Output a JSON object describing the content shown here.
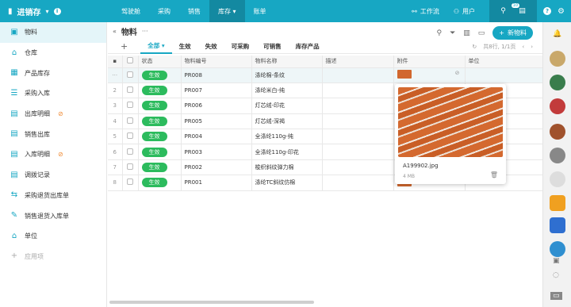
{
  "topbar": {
    "app_name": "进销存",
    "nav": [
      "驾驶舱",
      "采购",
      "销售",
      "库存",
      "账单"
    ],
    "active_nav": "库存",
    "workflow_label": "工作流",
    "user_label": "用户",
    "notif_count": "10"
  },
  "sidebar": {
    "items": [
      {
        "label": "物料",
        "icon": "box-icon",
        "active": true
      },
      {
        "label": "仓库",
        "icon": "warehouse-icon"
      },
      {
        "label": "产品库存",
        "icon": "inventory-icon"
      },
      {
        "label": "采购入库",
        "icon": "checklist-icon"
      },
      {
        "label": "出库明细",
        "icon": "document-icon",
        "hidden_icon": true
      },
      {
        "label": "销售出库",
        "icon": "document-icon"
      },
      {
        "label": "入库明细",
        "icon": "document-icon",
        "hidden_icon": true
      },
      {
        "label": "调拨记录",
        "icon": "document-icon"
      },
      {
        "label": "采购退货出库单",
        "icon": "transfer-icon"
      },
      {
        "label": "销售退货入库单",
        "icon": "edit-icon"
      },
      {
        "label": "单位",
        "icon": "home-icon"
      }
    ],
    "add_label": "应用项"
  },
  "main": {
    "title": "物料",
    "new_button": "新物料",
    "tabs": [
      "全部",
      "生效",
      "失效",
      "可采购",
      "可销售",
      "库存产品"
    ],
    "active_tab": "全部",
    "pagination": "共8行, 1/1页",
    "columns": [
      "状态",
      "物料编号",
      "物料名称",
      "描述",
      "附件",
      "单位"
    ],
    "rows": [
      {
        "idx": "1",
        "status": "生效",
        "code": "PR008",
        "name": "涤纶棉-条纹",
        "desc": "",
        "attach": true
      },
      {
        "idx": "2",
        "status": "生效",
        "code": "PR007",
        "name": "涤纶米白-纯",
        "desc": "",
        "attach": false
      },
      {
        "idx": "3",
        "status": "生效",
        "code": "PR006",
        "name": "灯芯绒-印花",
        "desc": "",
        "attach": false
      },
      {
        "idx": "4",
        "status": "生效",
        "code": "PR005",
        "name": "灯芯绒-深褐",
        "desc": "",
        "attach": false
      },
      {
        "idx": "5",
        "status": "生效",
        "code": "PR004",
        "name": "全涤纶110g-纯",
        "desc": "",
        "attach": false
      },
      {
        "idx": "6",
        "status": "生效",
        "code": "PR003",
        "name": "全涤纶110g-印花",
        "desc": "",
        "attach": false
      },
      {
        "idx": "7",
        "status": "生效",
        "code": "PR002",
        "name": "梭织斜纹弹力棉",
        "desc": "",
        "attach": false
      },
      {
        "idx": "8",
        "status": "生效",
        "code": "PR001",
        "name": "涤纶TC斜纹仿棉",
        "desc": "",
        "attach": true
      }
    ]
  },
  "popup": {
    "file_name": "A199902.jpg",
    "file_size": "4 MB"
  },
  "colors": {
    "primary": "#17a7c3",
    "status_green": "#2cbb5d",
    "fabric": "#d4692f"
  }
}
